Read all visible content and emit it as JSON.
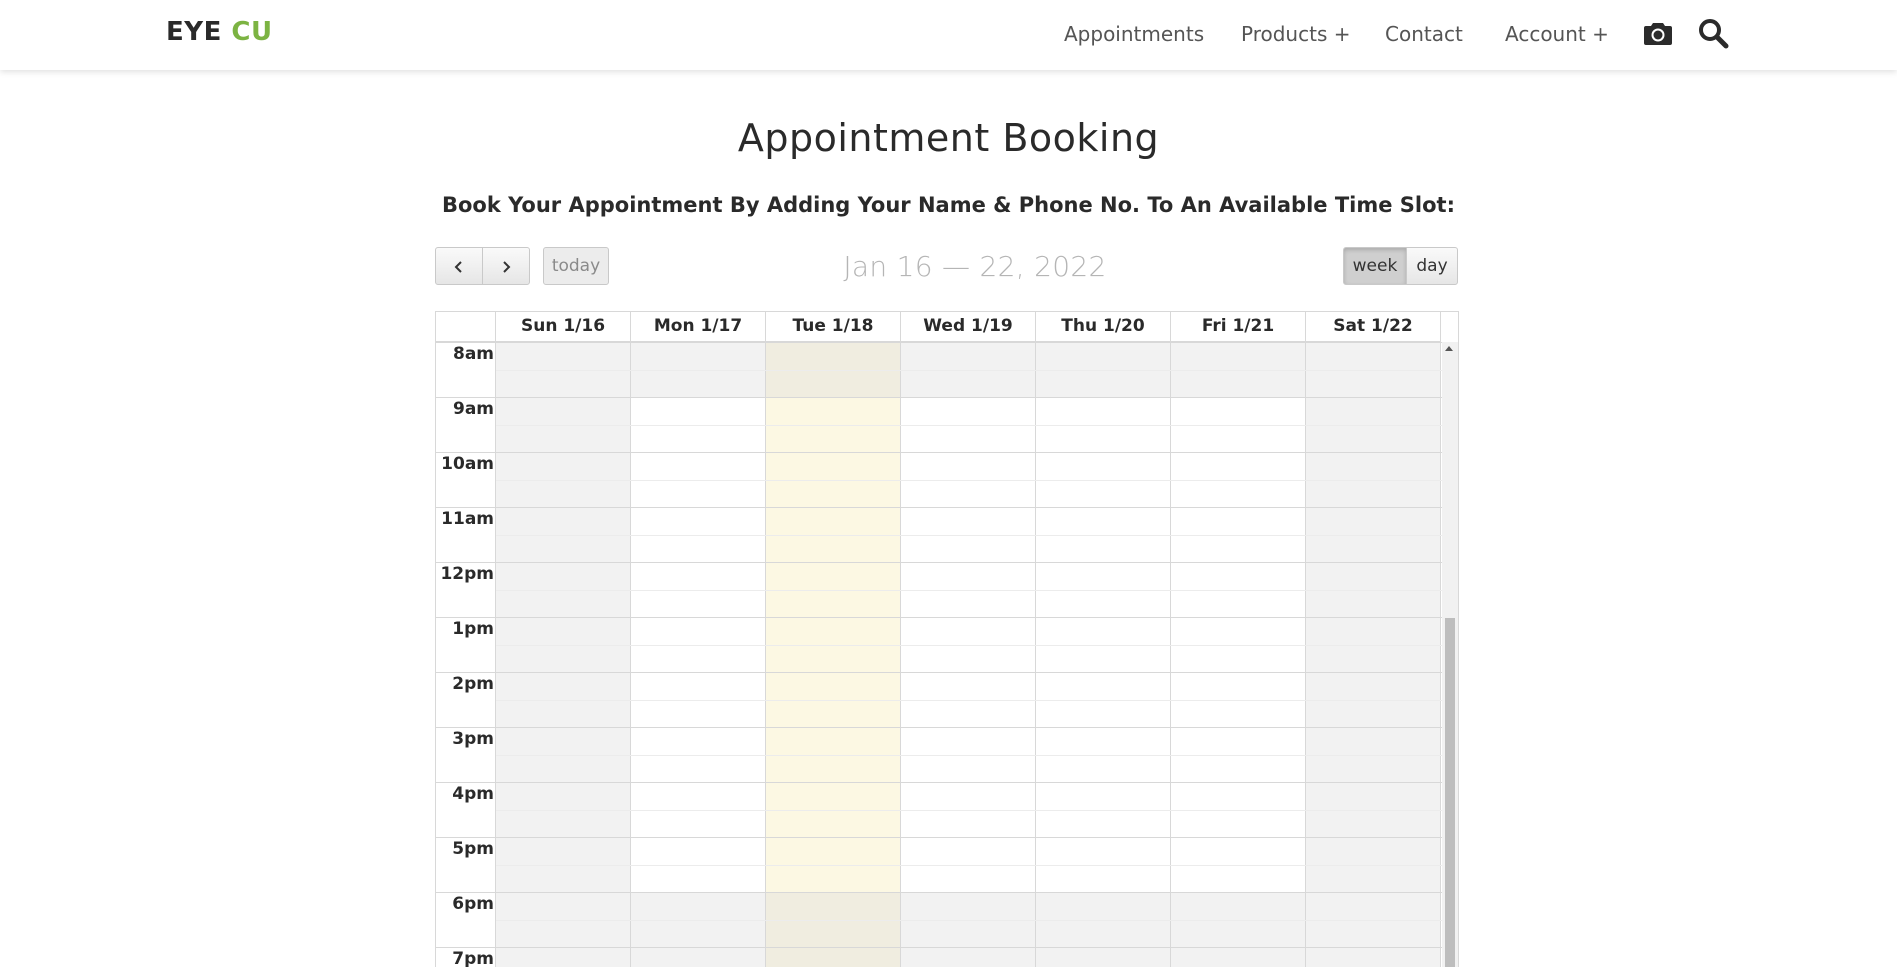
{
  "header": {
    "logo_main": "EYE",
    "logo_accent": "CU",
    "nav": [
      {
        "label": "Appointments",
        "name": "nav-appointments"
      },
      {
        "label": "Products +",
        "name": "nav-products"
      },
      {
        "label": "Contact",
        "name": "nav-contact"
      },
      {
        "label": "Account +",
        "name": "nav-account"
      }
    ],
    "icons": [
      "camera-icon",
      "search-icon"
    ]
  },
  "page": {
    "title": "Appointment Booking",
    "subtitle": "Book Your Appointment By Adding Your Name & Phone No. To An Available Time Slot:"
  },
  "toolbar": {
    "prev_icon": "chevron-left-icon",
    "next_icon": "chevron-right-icon",
    "today_label": "today",
    "range_title": "Jan 16 — 22, 2022",
    "views": [
      {
        "label": "week",
        "active": true
      },
      {
        "label": "day",
        "active": false
      }
    ]
  },
  "calendar": {
    "days": [
      "Sun 1/16",
      "Mon 1/17",
      "Tue 1/18",
      "Wed 1/19",
      "Thu 1/20",
      "Fri 1/21",
      "Sat 1/22"
    ],
    "today_index": 2,
    "closed_days": [
      0,
      6
    ],
    "times": [
      "8am",
      "9am",
      "10am",
      "11am",
      "12pm",
      "1pm",
      "2pm",
      "3pm",
      "4pm",
      "5pm",
      "6pm",
      "7pm"
    ],
    "open_hours_start_index": 1,
    "open_hours_end_index": 10,
    "colors": {
      "closed": "#f2f2f2",
      "today": "#fcf8e3",
      "today_closed": "#f0ede0",
      "open": "#ffffff",
      "accent": "#7cb342"
    }
  }
}
